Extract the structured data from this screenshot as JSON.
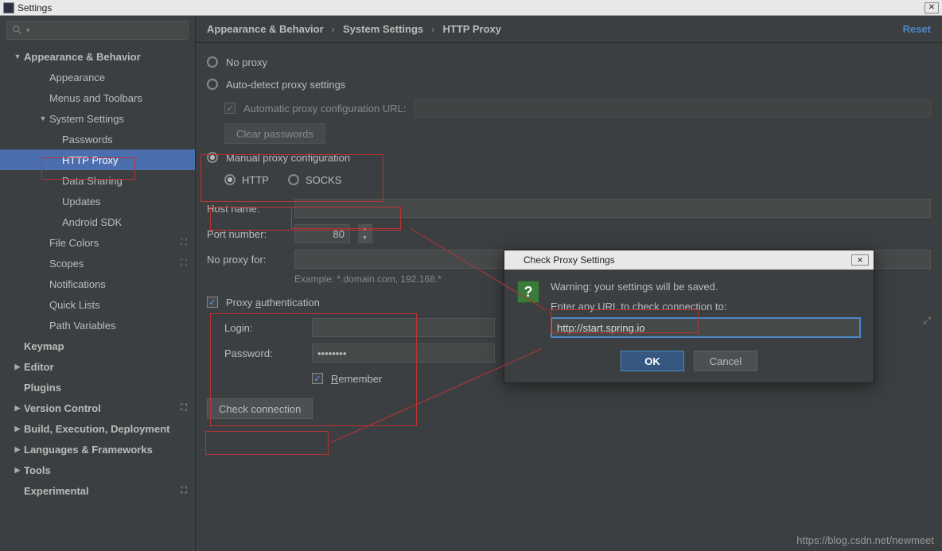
{
  "window": {
    "title": "Settings"
  },
  "search": {
    "placeholder": ""
  },
  "sidebar": {
    "items": [
      {
        "label": "Appearance & Behavior",
        "bold": true,
        "arrow": "▼",
        "lv": 0
      },
      {
        "label": "Appearance",
        "lv": 1
      },
      {
        "label": "Menus and Toolbars",
        "lv": 1
      },
      {
        "label": "System Settings",
        "arrow": "▼",
        "lv": 1
      },
      {
        "label": "Passwords",
        "lv": 2
      },
      {
        "label": "HTTP Proxy",
        "lv": 2,
        "selected": true
      },
      {
        "label": "Data Sharing",
        "lv": 2
      },
      {
        "label": "Updates",
        "lv": 2
      },
      {
        "label": "Android SDK",
        "lv": 2
      },
      {
        "label": "File Colors",
        "lv": 1,
        "tail": "⛶"
      },
      {
        "label": "Scopes",
        "lv": 1,
        "tail": "⛶"
      },
      {
        "label": "Notifications",
        "lv": 1
      },
      {
        "label": "Quick Lists",
        "lv": 1
      },
      {
        "label": "Path Variables",
        "lv": 1
      },
      {
        "label": "Keymap",
        "bold": true,
        "lv": 0
      },
      {
        "label": "Editor",
        "bold": true,
        "arrow": "▶",
        "lv": 0
      },
      {
        "label": "Plugins",
        "bold": true,
        "lv": 0
      },
      {
        "label": "Version Control",
        "bold": true,
        "arrow": "▶",
        "lv": 0,
        "tail": "⛶"
      },
      {
        "label": "Build, Execution, Deployment",
        "bold": true,
        "arrow": "▶",
        "lv": 0
      },
      {
        "label": "Languages & Frameworks",
        "bold": true,
        "arrow": "▶",
        "lv": 0
      },
      {
        "label": "Tools",
        "bold": true,
        "arrow": "▶",
        "lv": 0
      },
      {
        "label": "Experimental",
        "bold": true,
        "lv": 0,
        "tail": "⛶"
      }
    ]
  },
  "breadcrumb": {
    "a": "Appearance & Behavior",
    "b": "System Settings",
    "c": "HTTP Proxy",
    "reset": "Reset"
  },
  "proxy": {
    "no_proxy": "No proxy",
    "auto": "Auto-detect proxy settings",
    "auto_url": "Automatic proxy configuration URL:",
    "clear": "Clear passwords",
    "manual": "Manual proxy configuration",
    "http": "HTTP",
    "socks": "SOCKS",
    "host_label": "Host name:",
    "host_value": "",
    "port_label": "Port number:",
    "port_value": "80",
    "nofor_label": "No proxy for:",
    "nofor_value": "",
    "example": "Example: *.domain.com, 192.168.*",
    "auth": "Proxy authentication",
    "auth_prefix": "Proxy ",
    "auth_underline": "a",
    "auth_suffix": "uthentication",
    "login_label": "Login:",
    "login_value": "",
    "pwd_label": "Password:",
    "pwd_value": "••••••••",
    "remember_prefix": "",
    "remember_underline": "R",
    "remember_suffix": "emember",
    "check": "Check connection"
  },
  "dialog": {
    "title": "Check Proxy Settings",
    "warn": "Warning: your settings will be saved.",
    "prompt": "Enter any URL to check connection to:",
    "url": "http://start.spring.io",
    "ok": "OK",
    "cancel": "Cancel"
  },
  "watermark": "https://blog.csdn.net/newmeet"
}
